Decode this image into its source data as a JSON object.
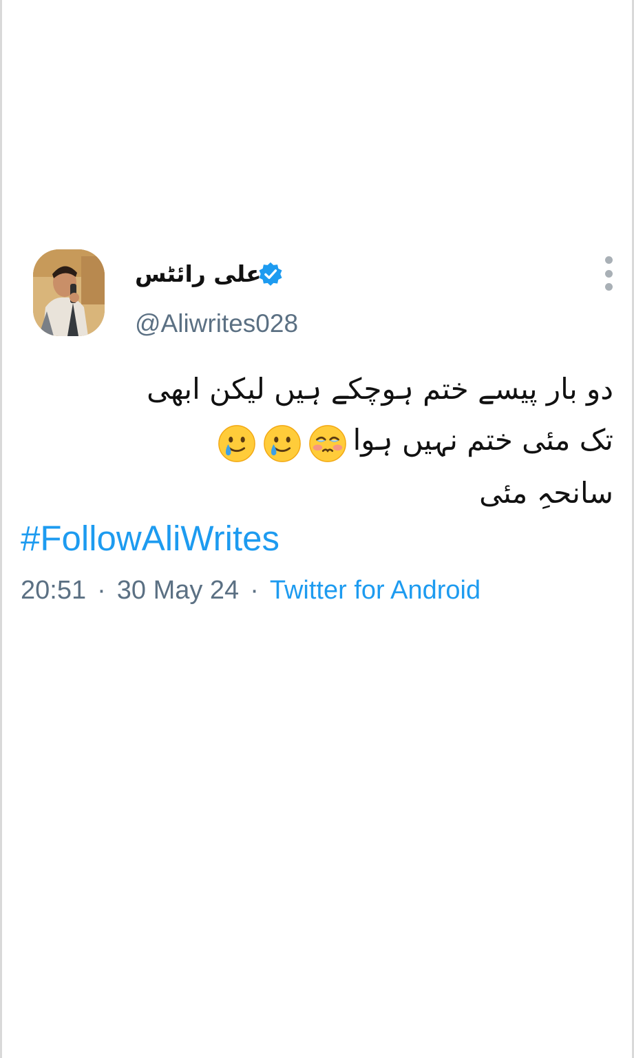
{
  "tweet": {
    "author": {
      "display_name": "علی رائٹس",
      "handle": "@Aliwrites028",
      "verified": true,
      "avatar_icon": "profile-photo"
    },
    "text_lines": [
      "دو بار پیسے ختم ہوچکے ہیں لیکن ابھی",
      "تک مئی ختم نہیں ہوا",
      "سانحہِ مئی"
    ],
    "emojis": [
      "face-holding-back-tears",
      "smiling-face-with-tear",
      "smiling-face-with-tear"
    ],
    "hashtag": "#FollowAliWrites",
    "time": "20:51",
    "date": "30 May 24",
    "separator": "·",
    "source": "Twitter for Android"
  },
  "colors": {
    "link_blue": "#1d9bf0",
    "muted_gray": "#5b7083",
    "text": "#111111",
    "verified_blue": "#1d9bf0"
  }
}
